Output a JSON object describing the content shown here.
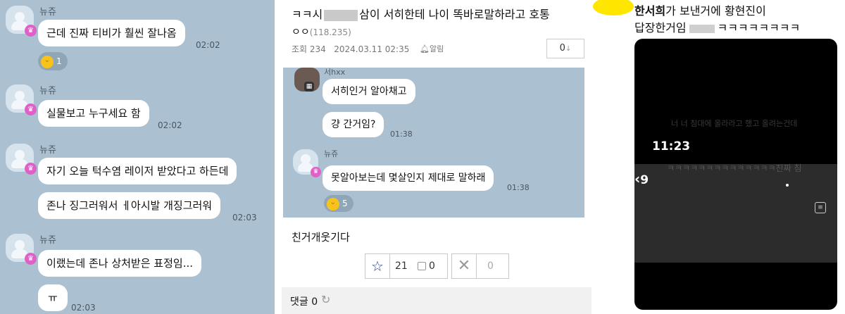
{
  "chat": {
    "sender": "뉴쥬",
    "messages": [
      {
        "text": "근데 진짜 티비가 훨씬 잘나옴",
        "time": "02:02",
        "reaction_count": "1"
      },
      {
        "text": "실물보고 누구세요 함",
        "time": "02:02"
      },
      {
        "text": "자기 오늘 턱수염 레이저 받았다고 하든데"
      },
      {
        "text": "존나 징그러워서  ㅔ아시발 개징그러워",
        "time": "02:03"
      },
      {
        "text": "이랬는데 존나 상처받은 표정임..."
      },
      {
        "text": "ㅠ",
        "time": "02:03"
      }
    ]
  },
  "post": {
    "title_prefix": "ㅋㅋ시",
    "title_suffix": "삼이 서히한테 나이 똑바로말하라고 호통",
    "author": "ㅇㅇ",
    "ip": "(118.235)",
    "meta": "조회 234   2024.03.11 02:35",
    "alarm_label": "알림",
    "comment_count_box": "0",
    "embedded": {
      "sender1": "서hxx",
      "bubble1": "서히인거 알아채고",
      "bubble2": "걍 간거임?",
      "time1": "01:38",
      "sender2": "뉴쥬",
      "bubble3": "못알아보는데 몇살인지 제대로 말하래",
      "time2": "01:38",
      "reaction_count": "5"
    },
    "body": "친거개웃기다",
    "recommend_count": "21",
    "fixed_count": "0",
    "unrecommend_count": "0",
    "comments_label": "댓글 0"
  },
  "story": {
    "caption_line1_bold": "한서희",
    "caption_line1_rest": "가 보낸거에 황현진이",
    "caption_line2": "답장한거임",
    "caption_line2_end": "ㅋㅋㅋㅋㅋㅋㅋㅋ",
    "time": "11:23",
    "back_count": "9",
    "faded_line1": "너 너 침대에 올라라고 했고 올려는건데",
    "faded_line2": "ㅋㅋㅋㅋㅋㅋㅋㅋㅋㅋㅋㅋㅋㅋ진짜 침"
  },
  "colors": {
    "chat_bg": "#abc1d1",
    "story_bg": "#000000",
    "highlight": "#ffe600"
  }
}
